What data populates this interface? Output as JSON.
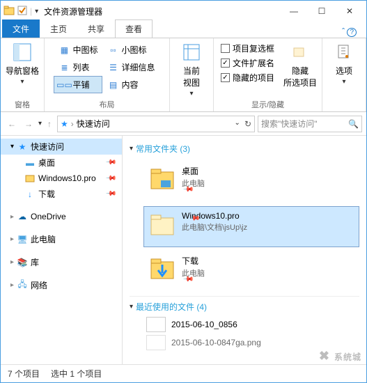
{
  "title": "文件资源管理器",
  "tabs": {
    "file": "文件",
    "home": "主页",
    "share": "共享",
    "view": "查看"
  },
  "ribbon": {
    "panes": {
      "navpane": "导航窗格",
      "paneGroup": "窗格"
    },
    "layout": {
      "medIcons": "中图标",
      "smallIcons": "小图标",
      "list": "列表",
      "details": "详细信息",
      "tiles": "平铺",
      "content": "内容",
      "group": "布局"
    },
    "current": {
      "btn": "当前\n视图"
    },
    "showhide": {
      "checkbox": "项目复选框",
      "ext": "文件扩展名",
      "hidden": "隐藏的项目",
      "hideSel": "隐藏\n所选项目",
      "group": "显示/隐藏"
    },
    "options": "选项"
  },
  "address": {
    "location": "快速访问",
    "searchPlaceholder": "搜索\"快速访问\""
  },
  "sidebar": {
    "quick": "快速访问",
    "items": [
      {
        "label": "桌面",
        "pinned": true
      },
      {
        "label": "Windows10.pro",
        "pinned": true
      },
      {
        "label": "下载",
        "pinned": true
      }
    ],
    "onedrive": "OneDrive",
    "thispc": "此电脑",
    "libraries": "库",
    "network": "网络"
  },
  "main": {
    "frequentHeader": "常用文件夹 (3)",
    "tiles": [
      {
        "name": "桌面",
        "sub": "此电脑",
        "pinned": true,
        "selected": false,
        "type": "desktop"
      },
      {
        "name": "Windows10.pro",
        "sub": "此电脑\\文档\\jsUp\\jz",
        "pinned": true,
        "selected": true,
        "type": "folder"
      },
      {
        "name": "下载",
        "sub": "此电脑",
        "pinned": true,
        "selected": false,
        "type": "downloads"
      }
    ],
    "recentHeader": "最近使用的文件 (4)",
    "recent": [
      "2015-06-10_0856",
      "2015-06-10-0847ga.png"
    ]
  },
  "status": {
    "total": "7 个项目",
    "selected": "选中 1 个项目"
  },
  "watermark": "系统城"
}
